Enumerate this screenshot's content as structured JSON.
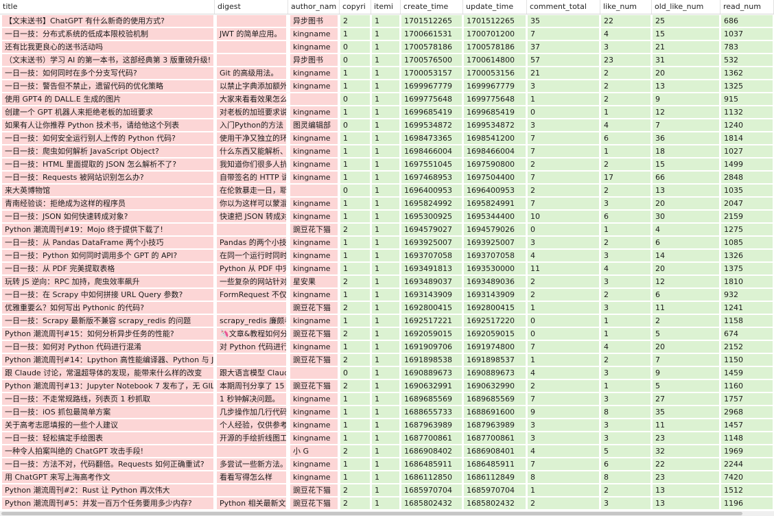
{
  "columns": [
    {
      "key": "title",
      "label": "title"
    },
    {
      "key": "digest",
      "label": "digest"
    },
    {
      "key": "author",
      "label": "author_nam"
    },
    {
      "key": "copyright",
      "label": "copyri"
    },
    {
      "key": "itemidx",
      "label": "itemi"
    },
    {
      "key": "create",
      "label": "create_time"
    },
    {
      "key": "update",
      "label": "update_time"
    },
    {
      "key": "comment",
      "label": "comment_total"
    },
    {
      "key": "like",
      "label": "like_num"
    },
    {
      "key": "oldlike",
      "label": "old_like_num"
    },
    {
      "key": "read",
      "label": "read_num"
    }
  ],
  "cell_colors": {
    "text": "#fcd6d6",
    "number": "#dcf2d2"
  },
  "rows": [
    [
      "【文末送书】ChatGPT 有什么新奇的使用方式?",
      "",
      "异步图书",
      "2",
      "1",
      "1701512265",
      "1701512265",
      "35",
      "22",
      "25",
      "686"
    ],
    [
      "一日一技：分布式系统的低成本限校验机制",
      "JWT 的简单应用。",
      "kingname",
      "1",
      "1",
      "1700661531",
      "1700701200",
      "7",
      "4",
      "15",
      "1037"
    ],
    [
      "还有比我更良心的送书活动吗",
      "",
      "kingname",
      "0",
      "1",
      "1700578186",
      "1700578186",
      "37",
      "3",
      "21",
      "783"
    ],
    [
      "（文末送书）学习 AI 的第一本书，这部经典第 3 版重磅升级!",
      "",
      "异步图书",
      "0",
      "1",
      "1700576500",
      "1700614800",
      "57",
      "23",
      "31",
      "532"
    ],
    [
      "一日一技：如何同时在多个分支写代码?",
      "Git 的高级用法。",
      "kingname",
      "1",
      "1",
      "1700053157",
      "1700053156",
      "21",
      "2",
      "20",
      "1362"
    ],
    [
      "一日一技：警告但不禁止，遗留代码的优化策略",
      "以禁止字典添加额外",
      "kingname",
      "1",
      "1",
      "1699967779",
      "1699967779",
      "3",
      "2",
      "13",
      "1325"
    ],
    [
      "使用 GPT4 的 DALL.E 生成的图片",
      "大家来看看效果怎么",
      "",
      "0",
      "1",
      "1699775648",
      "1699775648",
      "1",
      "2",
      "9",
      "915"
    ],
    [
      "创建一个 GPT 机器人来拒绝老板的加班要求",
      "对老板的加班要求说",
      "kingname",
      "1",
      "1",
      "1699685419",
      "1699685419",
      "0",
      "1",
      "12",
      "1132"
    ],
    [
      "如果有人让你推荐 Python 技术书，请给他这个列表",
      "入门Python的方法",
      "图灵编辑部",
      "0",
      "1",
      "1699534872",
      "1699534872",
      "3",
      "4",
      "7",
      "1240"
    ],
    [
      "一日一技：如何安全运行别人上传的 Python 代码?",
      "使用干净又独立的环",
      "kingname",
      "1",
      "1",
      "1698473365",
      "1698541200",
      "7",
      "6",
      "36",
      "1814"
    ],
    [
      "一日一技：爬虫如何解析 JavaScript Object?",
      "什么东西又能解析、",
      "kingname",
      "1",
      "1",
      "1698466004",
      "1698466004",
      "7",
      "1",
      "18",
      "1027"
    ],
    [
      "一日一技：HTML 里面提取的 JSON 怎么解析不了?",
      "我知道你们很多人抗",
      "kingname",
      "1",
      "1",
      "1697551045",
      "1697590800",
      "2",
      "2",
      "15",
      "1499"
    ],
    [
      "一日一技：Requests 被网站识别怎么办?",
      "自带签名的 HTTP 请",
      "kingname",
      "1",
      "1",
      "1697468953",
      "1697504400",
      "7",
      "17",
      "66",
      "2848"
    ],
    [
      "来大英博物馆",
      "在伦敦暴走一日，耶",
      "",
      "0",
      "1",
      "1696400953",
      "1696400953",
      "2",
      "2",
      "13",
      "1035"
    ],
    [
      "青南经验谈：拒绝成为这样的程序员",
      "你以为这样可以蒙混",
      "kingname",
      "1",
      "1",
      "1695824992",
      "1695824991",
      "7",
      "3",
      "20",
      "2047"
    ],
    [
      "一日一技：JSON 如何快速转成对象?",
      "快速把 JSON 转成对",
      "kingname",
      "1",
      "1",
      "1695300925",
      "1695344400",
      "10",
      "6",
      "30",
      "2159"
    ],
    [
      "Python 潮流周刊#19：Mojo 终于提供下载了!",
      "",
      "豌豆花下猫",
      "2",
      "1",
      "1694579027",
      "1694579026",
      "0",
      "1",
      "4",
      "1275"
    ],
    [
      "一日一技：从 Pandas DataFrame 两个小技巧",
      "Pandas 的两个小技",
      "kingname",
      "1",
      "1",
      "1693925007",
      "1693925007",
      "3",
      "2",
      "6",
      "1085"
    ],
    [
      "一日一技：Python 如何同时调用多个 GPT 的 API?",
      "在同一个运行时同时",
      "kingname",
      "1",
      "1",
      "1693707058",
      "1693707058",
      "4",
      "3",
      "14",
      "1326"
    ],
    [
      "一日一技：从 PDF 完美提取表格",
      "Python 从 PDF 中完",
      "kingname",
      "1",
      "1",
      "1693491813",
      "1693530000",
      "11",
      "4",
      "20",
      "1375"
    ],
    [
      "玩转 JS 逆向：RPC 加持，爬虫效率飙升",
      "一些复杂的网站针对",
      "星安果",
      "2",
      "1",
      "1693489037",
      "1693489036",
      "2",
      "3",
      "12",
      "1810"
    ],
    [
      "一日一技：在 Scrapy 中如何拼接 URL Query 参数?",
      "FormRequest 不仅可",
      "kingname",
      "1",
      "1",
      "1693143909",
      "1693143909",
      "2",
      "2",
      "6",
      "932"
    ],
    [
      "优雅重要么？如何写出 Pythonic 的代码?",
      "",
      "豌豆花下猫",
      "2",
      "1",
      "1692800415",
      "1692800415",
      "1",
      "3",
      "11",
      "1241"
    ],
    [
      "一日一技：Scrapy 最新版不兼容 scrapy_redis 的问题",
      "scrapy_redis 廉颇老",
      "kingname",
      "1",
      "1",
      "1692517221",
      "1692517220",
      "0",
      "1",
      "2",
      "1158"
    ],
    [
      "Python 潮流周刊#15：如何分析异步任务的性能?",
      "🦄文章&教程如何分",
      "豌豆花下猫",
      "2",
      "1",
      "1692059015",
      "1692059015",
      "0",
      "1",
      "5",
      "674"
    ],
    [
      "一日一技：如何对 Python 代码进行混淆",
      "对 Python 代码进行",
      "kingname",
      "1",
      "1",
      "1691909706",
      "1691974800",
      "7",
      "4",
      "20",
      "2152"
    ],
    [
      "Python 潮流周刊#14：Lpython 高性能编译器、Python 与 JS",
      "",
      "豌豆花下猫",
      "2",
      "1",
      "1691898538",
      "1691898537",
      "1",
      "2",
      "7",
      "1150"
    ],
    [
      "跟 Claude 讨论，常温超导体的发现，能带来什么样的改变",
      "跟大语言模型 Claude",
      "",
      "0",
      "1",
      "1690889673",
      "1690889673",
      "4",
      "3",
      "9",
      "1459"
    ],
    [
      "Python 潮流周刊#13：Jupyter Notebook 7 发布了，无 GIL",
      "本期周刊分享了 15",
      "豌豆花下猫",
      "2",
      "1",
      "1690632991",
      "1690632990",
      "2",
      "1",
      "5",
      "1160"
    ],
    [
      "一日一技：不走常规路线，列表页 1 秒抓取",
      "1 秒钟解决问题。",
      "kingname",
      "1",
      "1",
      "1689685569",
      "1689685569",
      "7",
      "3",
      "27",
      "1757"
    ],
    [
      "一日一技：iOS 抓包最简单方案",
      "几步操作加几行代码",
      "kingname",
      "1",
      "1",
      "1688655733",
      "1688691600",
      "9",
      "8",
      "35",
      "2968"
    ],
    [
      "关于高考志愿填报的一些个人建议",
      "个人经验，仅供参考",
      "kingname",
      "1",
      "1",
      "1687963989",
      "1687963989",
      "3",
      "3",
      "11",
      "1457"
    ],
    [
      "一日一技：轻松搞定手绘图表",
      "开源的手绘折线图工",
      "kingname",
      "1",
      "1",
      "1687700861",
      "1687700861",
      "3",
      "3",
      "23",
      "1148"
    ],
    [
      "一种令人拍案叫绝的 ChatGPT 攻击手段!",
      "",
      "小 G",
      "2",
      "1",
      "1686908402",
      "1686908401",
      "4",
      "5",
      "32",
      "1969"
    ],
    [
      "一日一技：方法不对，代码翻倍。Requests 如何正确重试?",
      "多尝试一些新方法。",
      "kingname",
      "1",
      "1",
      "1686485911",
      "1686485911",
      "7",
      "6",
      "22",
      "2244"
    ],
    [
      "用 ChatGPT 来写上海高考作文",
      "看看写得怎么样",
      "kingname",
      "1",
      "1",
      "1686112850",
      "1686112849",
      "8",
      "8",
      "23",
      "7420"
    ],
    [
      "Python 潮流周刊#2：Rust 让 Python 再次伟大",
      "",
      "豌豆花下猫",
      "2",
      "1",
      "1685970704",
      "1685970704",
      "1",
      "2",
      "13",
      "1512"
    ],
    [
      "Python 潮流周刊#5：并发一百万个任务要用多少内存?",
      "Python 相关最新文",
      "豌豆花下猫",
      "2",
      "1",
      "1685802432",
      "1685802432",
      "2",
      "3",
      "13",
      "1196"
    ]
  ]
}
